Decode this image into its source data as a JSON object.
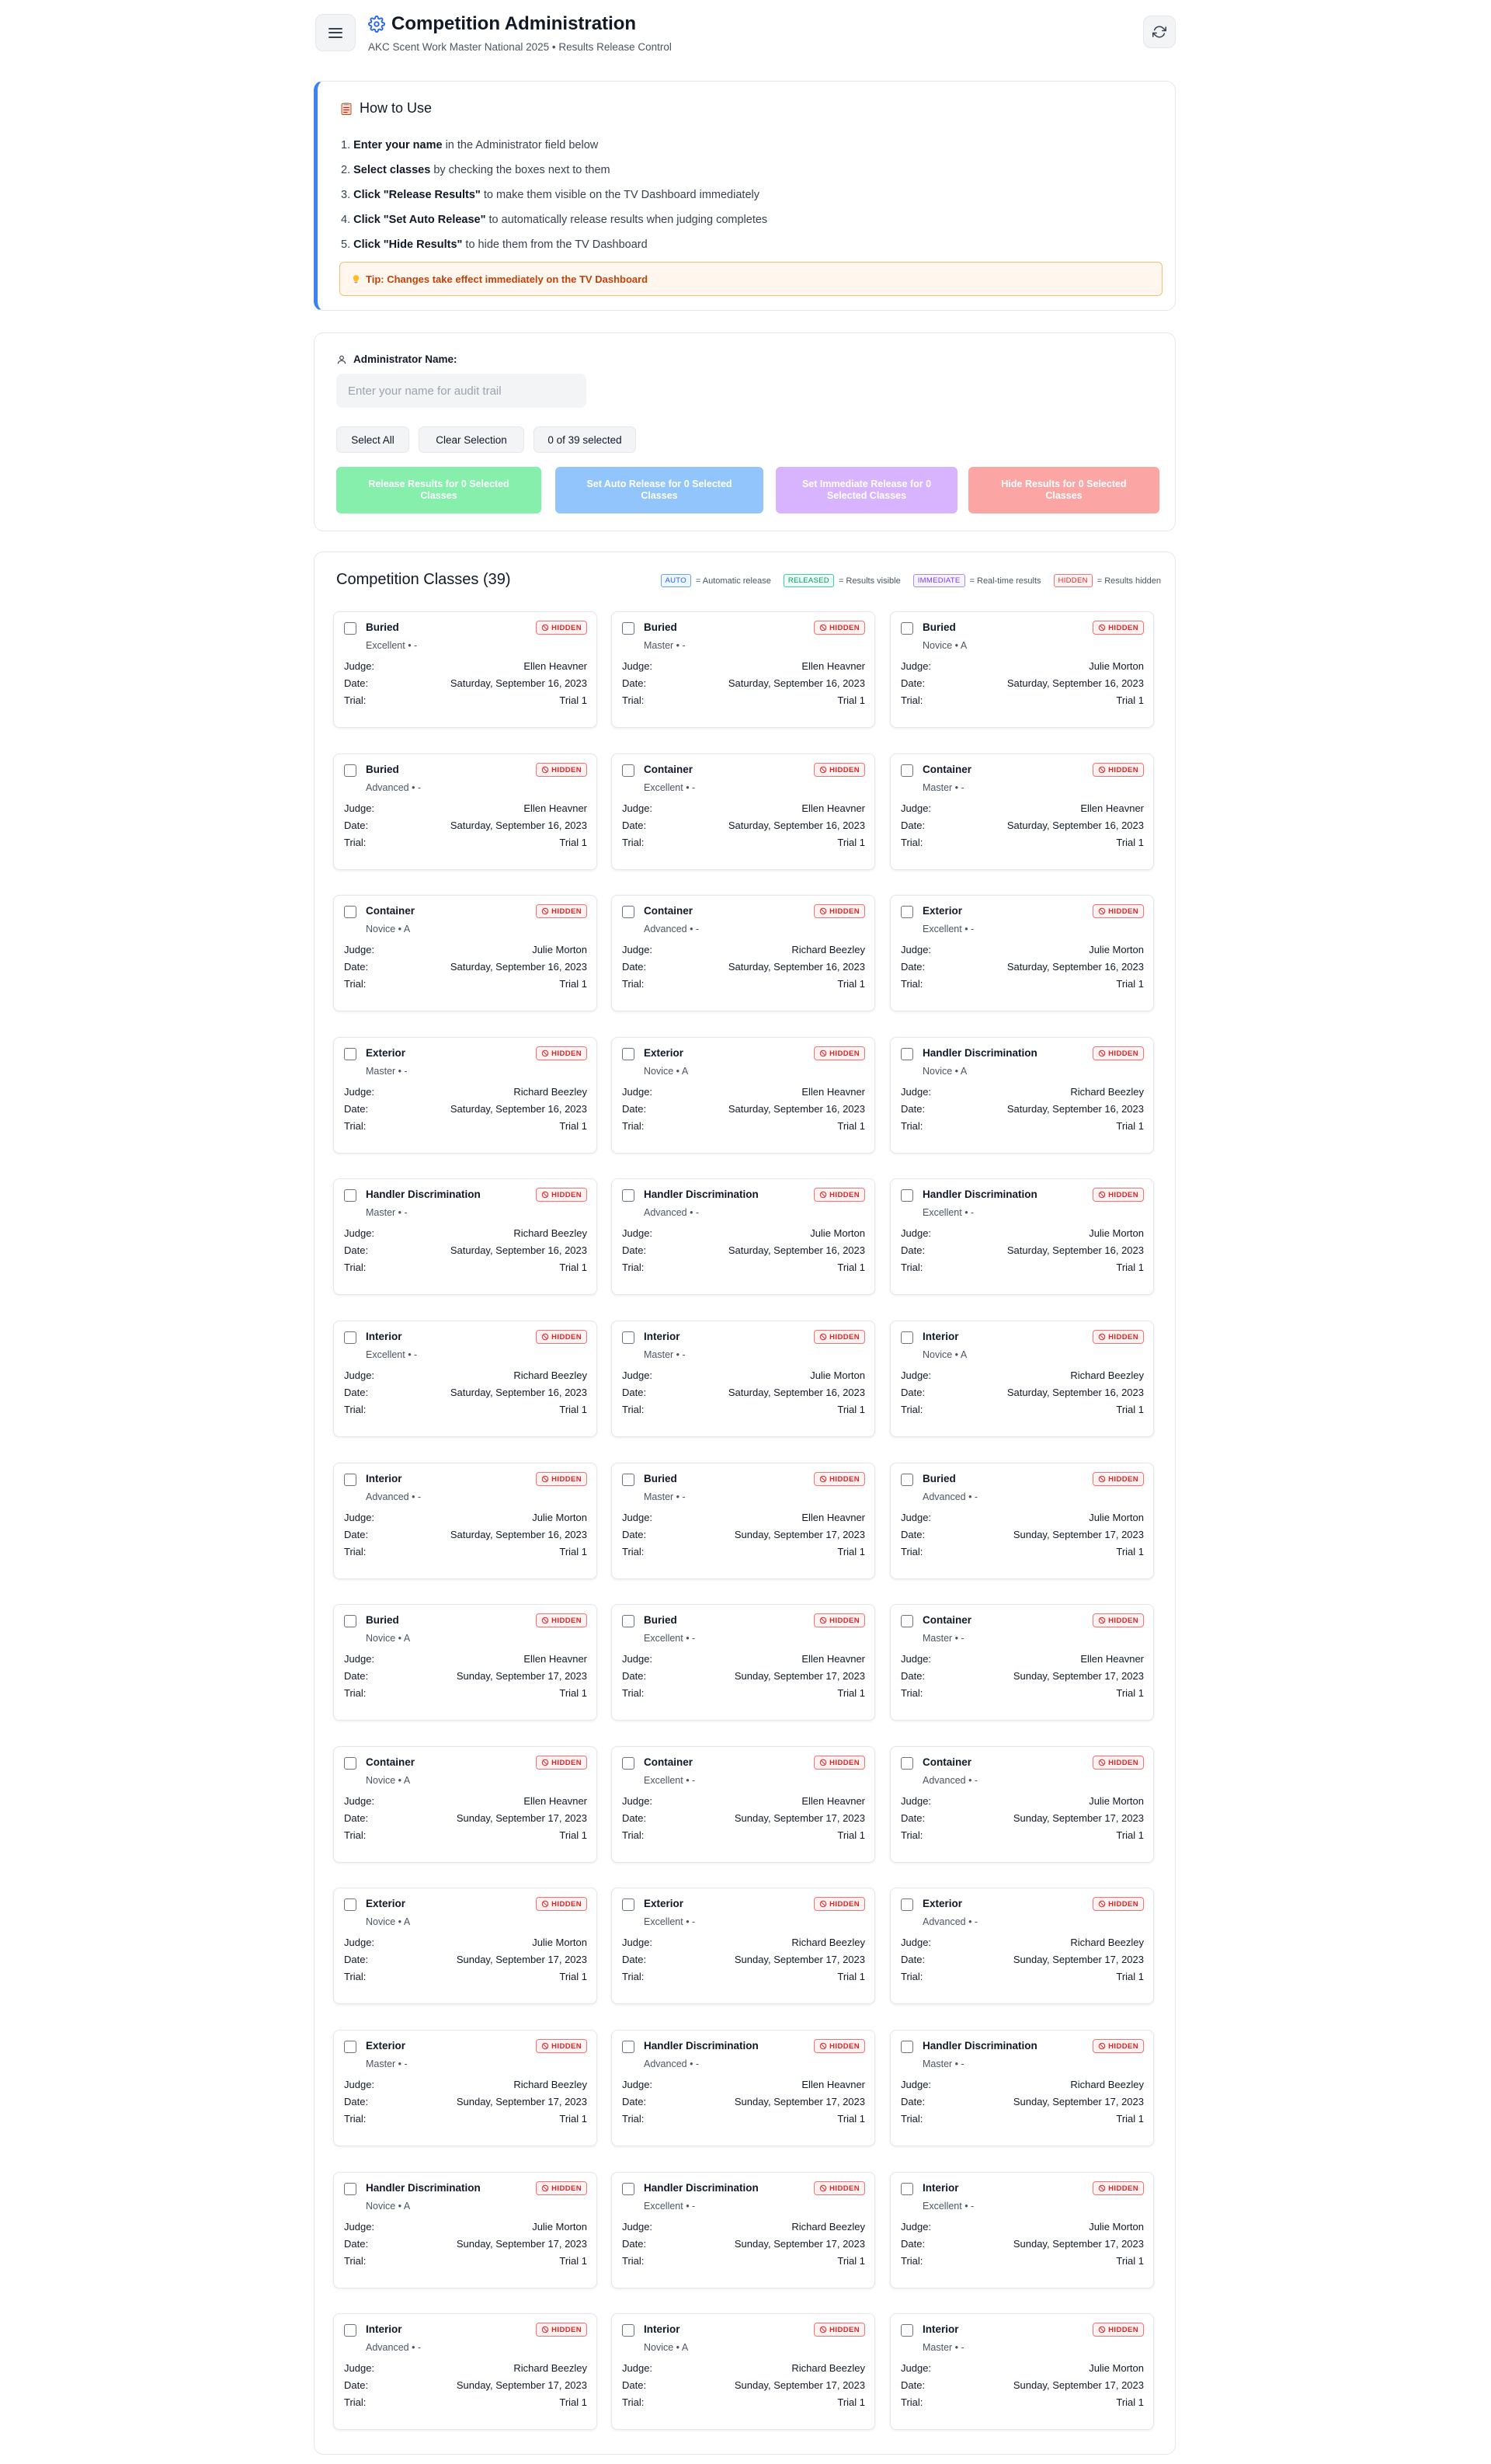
{
  "header": {
    "title": "Competition Administration",
    "subtitle": "AKC Scent Work Master National 2025 • Results Release Control"
  },
  "howto": {
    "title": "How to Use",
    "steps": [
      {
        "bold": "Enter your name",
        "rest": " in the Administrator field below"
      },
      {
        "bold": "Select classes",
        "rest": " by checking the boxes next to them"
      },
      {
        "bold": "Click \"Release Results\"",
        "rest": " to make them visible on the TV Dashboard immediately"
      },
      {
        "bold": "Click \"Set Auto Release\"",
        "rest": " to automatically release results when judging completes"
      },
      {
        "bold": "Click \"Hide Results\"",
        "rest": " to hide them from the TV Dashboard"
      }
    ],
    "tip": "Tip: Changes take effect immediately on the TV Dashboard"
  },
  "controls": {
    "admin_label": "Administrator Name:",
    "admin_placeholder": "Enter your name for audit trail",
    "admin_value": "",
    "select_all": "Select All",
    "clear_selection": "Clear Selection",
    "selection_count": "0 of 39 selected",
    "release_label": "Release Results for 0 Selected Classes",
    "auto_release_label": "Set Auto Release for 0 Selected Classes",
    "immediate_release_label": "Set Immediate Release for 0 Selected Classes",
    "hide_label": "Hide Results for 0 Selected Classes"
  },
  "classes_section": {
    "title": "Competition Classes (39)",
    "legend": [
      {
        "badge": "AUTO",
        "text": "= Automatic release"
      },
      {
        "badge": "RELEASED",
        "text": "= Results visible"
      },
      {
        "badge": "IMMEDIATE",
        "text": "= Real-time results"
      },
      {
        "badge": "HIDDEN",
        "text": "= Results hidden"
      }
    ],
    "labels": {
      "judge": "Judge:",
      "date": "Date:",
      "trial": "Trial:"
    }
  },
  "classes": [
    {
      "name": "Buried",
      "level": "Excellent • -",
      "status": "HIDDEN",
      "judge": "Ellen Heavner",
      "date": "Saturday, September 16, 2023",
      "trial": "Trial 1"
    },
    {
      "name": "Buried",
      "level": "Master • -",
      "status": "HIDDEN",
      "judge": "Ellen Heavner",
      "date": "Saturday, September 16, 2023",
      "trial": "Trial 1"
    },
    {
      "name": "Buried",
      "level": "Novice • A",
      "status": "HIDDEN",
      "judge": "Julie Morton",
      "date": "Saturday, September 16, 2023",
      "trial": "Trial 1"
    },
    {
      "name": "Buried",
      "level": "Advanced • -",
      "status": "HIDDEN",
      "judge": "Ellen Heavner",
      "date": "Saturday, September 16, 2023",
      "trial": "Trial 1"
    },
    {
      "name": "Container",
      "level": "Excellent • -",
      "status": "HIDDEN",
      "judge": "Ellen Heavner",
      "date": "Saturday, September 16, 2023",
      "trial": "Trial 1"
    },
    {
      "name": "Container",
      "level": "Master • -",
      "status": "HIDDEN",
      "judge": "Ellen Heavner",
      "date": "Saturday, September 16, 2023",
      "trial": "Trial 1"
    },
    {
      "name": "Container",
      "level": "Novice • A",
      "status": "HIDDEN",
      "judge": "Julie Morton",
      "date": "Saturday, September 16, 2023",
      "trial": "Trial 1"
    },
    {
      "name": "Container",
      "level": "Advanced • -",
      "status": "HIDDEN",
      "judge": "Richard Beezley",
      "date": "Saturday, September 16, 2023",
      "trial": "Trial 1"
    },
    {
      "name": "Exterior",
      "level": "Excellent • -",
      "status": "HIDDEN",
      "judge": "Julie Morton",
      "date": "Saturday, September 16, 2023",
      "trial": "Trial 1"
    },
    {
      "name": "Exterior",
      "level": "Master • -",
      "status": "HIDDEN",
      "judge": "Richard Beezley",
      "date": "Saturday, September 16, 2023",
      "trial": "Trial 1"
    },
    {
      "name": "Exterior",
      "level": "Novice • A",
      "status": "HIDDEN",
      "judge": "Ellen Heavner",
      "date": "Saturday, September 16, 2023",
      "trial": "Trial 1"
    },
    {
      "name": "Handler Discrimination",
      "level": "Novice • A",
      "status": "HIDDEN",
      "judge": "Richard Beezley",
      "date": "Saturday, September 16, 2023",
      "trial": "Trial 1"
    },
    {
      "name": "Handler Discrimination",
      "level": "Master • -",
      "status": "HIDDEN",
      "judge": "Richard Beezley",
      "date": "Saturday, September 16, 2023",
      "trial": "Trial 1"
    },
    {
      "name": "Handler Discrimination",
      "level": "Advanced • -",
      "status": "HIDDEN",
      "judge": "Julie Morton",
      "date": "Saturday, September 16, 2023",
      "trial": "Trial 1"
    },
    {
      "name": "Handler Discrimination",
      "level": "Excellent • -",
      "status": "HIDDEN",
      "judge": "Julie Morton",
      "date": "Saturday, September 16, 2023",
      "trial": "Trial 1"
    },
    {
      "name": "Interior",
      "level": "Excellent • -",
      "status": "HIDDEN",
      "judge": "Richard Beezley",
      "date": "Saturday, September 16, 2023",
      "trial": "Trial 1"
    },
    {
      "name": "Interior",
      "level": "Master • -",
      "status": "HIDDEN",
      "judge": "Julie Morton",
      "date": "Saturday, September 16, 2023",
      "trial": "Trial 1"
    },
    {
      "name": "Interior",
      "level": "Novice • A",
      "status": "HIDDEN",
      "judge": "Richard Beezley",
      "date": "Saturday, September 16, 2023",
      "trial": "Trial 1"
    },
    {
      "name": "Interior",
      "level": "Advanced • -",
      "status": "HIDDEN",
      "judge": "Julie Morton",
      "date": "Saturday, September 16, 2023",
      "trial": "Trial 1"
    },
    {
      "name": "Buried",
      "level": "Master • -",
      "status": "HIDDEN",
      "judge": "Ellen Heavner",
      "date": "Sunday, September 17, 2023",
      "trial": "Trial 1"
    },
    {
      "name": "Buried",
      "level": "Advanced • -",
      "status": "HIDDEN",
      "judge": "Julie Morton",
      "date": "Sunday, September 17, 2023",
      "trial": "Trial 1"
    },
    {
      "name": "Buried",
      "level": "Novice • A",
      "status": "HIDDEN",
      "judge": "Ellen Heavner",
      "date": "Sunday, September 17, 2023",
      "trial": "Trial 1"
    },
    {
      "name": "Buried",
      "level": "Excellent • -",
      "status": "HIDDEN",
      "judge": "Ellen Heavner",
      "date": "Sunday, September 17, 2023",
      "trial": "Trial 1"
    },
    {
      "name": "Container",
      "level": "Master • -",
      "status": "HIDDEN",
      "judge": "Ellen Heavner",
      "date": "Sunday, September 17, 2023",
      "trial": "Trial 1"
    },
    {
      "name": "Container",
      "level": "Novice • A",
      "status": "HIDDEN",
      "judge": "Ellen Heavner",
      "date": "Sunday, September 17, 2023",
      "trial": "Trial 1"
    },
    {
      "name": "Container",
      "level": "Excellent • -",
      "status": "HIDDEN",
      "judge": "Ellen Heavner",
      "date": "Sunday, September 17, 2023",
      "trial": "Trial 1"
    },
    {
      "name": "Container",
      "level": "Advanced • -",
      "status": "HIDDEN",
      "judge": "Julie Morton",
      "date": "Sunday, September 17, 2023",
      "trial": "Trial 1"
    },
    {
      "name": "Exterior",
      "level": "Novice • A",
      "status": "HIDDEN",
      "judge": "Julie Morton",
      "date": "Sunday, September 17, 2023",
      "trial": "Trial 1"
    },
    {
      "name": "Exterior",
      "level": "Excellent • -",
      "status": "HIDDEN",
      "judge": "Richard Beezley",
      "date": "Sunday, September 17, 2023",
      "trial": "Trial 1"
    },
    {
      "name": "Exterior",
      "level": "Advanced • -",
      "status": "HIDDEN",
      "judge": "Richard Beezley",
      "date": "Sunday, September 17, 2023",
      "trial": "Trial 1"
    },
    {
      "name": "Exterior",
      "level": "Master • -",
      "status": "HIDDEN",
      "judge": "Richard Beezley",
      "date": "Sunday, September 17, 2023",
      "trial": "Trial 1"
    },
    {
      "name": "Handler Discrimination",
      "level": "Advanced • -",
      "status": "HIDDEN",
      "judge": "Ellen Heavner",
      "date": "Sunday, September 17, 2023",
      "trial": "Trial 1"
    },
    {
      "name": "Handler Discrimination",
      "level": "Master • -",
      "status": "HIDDEN",
      "judge": "Richard Beezley",
      "date": "Sunday, September 17, 2023",
      "trial": "Trial 1"
    },
    {
      "name": "Handler Discrimination",
      "level": "Novice • A",
      "status": "HIDDEN",
      "judge": "Julie Morton",
      "date": "Sunday, September 17, 2023",
      "trial": "Trial 1"
    },
    {
      "name": "Handler Discrimination",
      "level": "Excellent • -",
      "status": "HIDDEN",
      "judge": "Richard Beezley",
      "date": "Sunday, September 17, 2023",
      "trial": "Trial 1"
    },
    {
      "name": "Interior",
      "level": "Excellent • -",
      "status": "HIDDEN",
      "judge": "Julie Morton",
      "date": "Sunday, September 17, 2023",
      "trial": "Trial 1"
    },
    {
      "name": "Interior",
      "level": "Advanced • -",
      "status": "HIDDEN",
      "judge": "Richard Beezley",
      "date": "Sunday, September 17, 2023",
      "trial": "Trial 1"
    },
    {
      "name": "Interior",
      "level": "Novice • A",
      "status": "HIDDEN",
      "judge": "Richard Beezley",
      "date": "Sunday, September 17, 2023",
      "trial": "Trial 1"
    },
    {
      "name": "Interior",
      "level": "Master • -",
      "status": "HIDDEN",
      "judge": "Julie Morton",
      "date": "Sunday, September 17, 2023",
      "trial": "Trial 1"
    }
  ],
  "colors": {
    "accent": "#3b82f6",
    "hidden": "#dc2626",
    "release": "#86efac",
    "auto": "#93c5fd",
    "immediate": "#d8b4fe",
    "hide": "#fca5a5",
    "tip": "#c2410c"
  },
  "icons": {
    "menu": "hamburger-icon",
    "title": "gear-icon",
    "refresh": "refresh-icon",
    "howto": "clipboard-icon",
    "tip": "lightbulb-icon",
    "admin": "user-icon",
    "hidden_badge": "eye-off-icon"
  }
}
